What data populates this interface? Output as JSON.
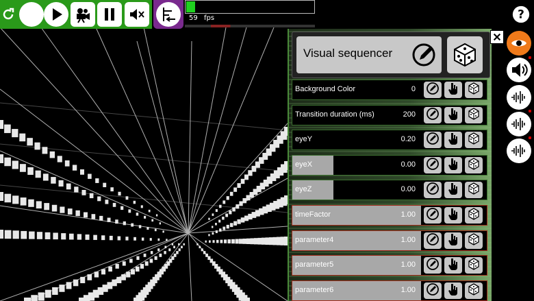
{
  "toolbar": {
    "buttons": [
      {
        "name": "reload-icon"
      },
      {
        "name": "record-icon"
      },
      {
        "name": "play-icon"
      },
      {
        "name": "camera-icon"
      },
      {
        "name": "pause-icon"
      },
      {
        "name": "mute-icon"
      }
    ],
    "special_button": {
      "name": "timeline-icon"
    },
    "accent_green": "#2a9a1a",
    "accent_purple": "#7a2a8e"
  },
  "fps": {
    "value": "59",
    "unit": "fps",
    "level": 0.07
  },
  "panel": {
    "title": "Visual sequencer",
    "parameters": [
      {
        "label": "Background Color",
        "value": "0",
        "fill": 0.0,
        "border": "green"
      },
      {
        "label": "Transition duration (ms)",
        "value": "200",
        "fill": 0.0,
        "border": "green"
      },
      {
        "label": "eyeY",
        "value": "0.20",
        "fill": 0.0,
        "border": "green"
      },
      {
        "label": "eyeX",
        "value": "0.00",
        "fill": 0.32,
        "border": "green"
      },
      {
        "label": "eyeZ",
        "value": "0.00",
        "fill": 0.32,
        "border": "green"
      },
      {
        "label": "timeFactor",
        "value": "1.00",
        "fill": 1.0,
        "border": "red"
      },
      {
        "label": "parameter4",
        "value": "1.00",
        "fill": 1.0,
        "border": "red"
      },
      {
        "label": "parameter5",
        "value": "1.00",
        "fill": 1.0,
        "border": "red"
      },
      {
        "label": "parameter6",
        "value": "1.00",
        "fill": 1.0,
        "border": "red"
      }
    ]
  },
  "right_column": [
    {
      "name": "help-icon"
    },
    {
      "name": "eye-icon",
      "active": true
    },
    {
      "name": "speaker-icon"
    },
    {
      "name": "waveform-icon"
    },
    {
      "name": "waveform-icon"
    },
    {
      "name": "waveform-icon"
    }
  ],
  "colors": {
    "active_orange": "#f07a1a",
    "row_fill": "#a8a8a8"
  }
}
